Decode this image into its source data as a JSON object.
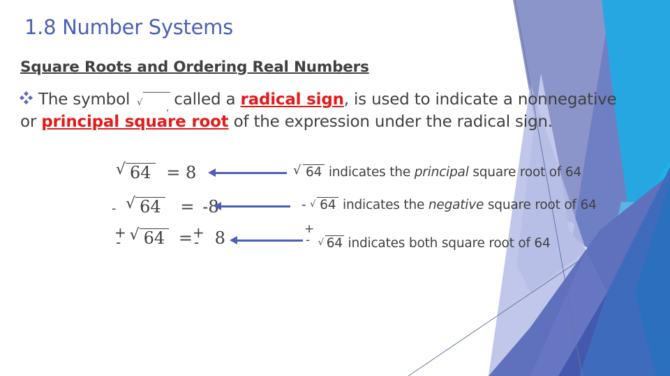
{
  "slide": {
    "title": "1.8 Number Systems",
    "subtitle": "Square Roots and Ordering Real Numbers",
    "bullet": {
      "icon": "diamond-bullet-icon",
      "text_before_symbol": "The symbol",
      "symbol": "√",
      "text_after_symbol": "called a",
      "term1": "radical sign",
      "text_mid": ", is used to indicate a nonnegative or",
      "term2": "principal square root",
      "text_end": "of the expression under the radical sign."
    },
    "equations": [
      {
        "prefix": "",
        "radicand": "64",
        "equals": "=",
        "result_prefix": "",
        "result": "8"
      },
      {
        "prefix": "-",
        "radicand": "64",
        "equals": "=",
        "result_prefix": "",
        "result": "-8"
      },
      {
        "prefix": "±",
        "radicand": "64",
        "equals": "=",
        "result_prefix": "±",
        "result": "8"
      }
    ],
    "descriptions": [
      {
        "prefix": "",
        "radicand": "64",
        "pre": "indicates the",
        "emph": "principal",
        "post": "square root of 64"
      },
      {
        "prefix": "-",
        "radicand": "64",
        "pre": "indicates the",
        "emph": "negative",
        "post": "square root of 64"
      },
      {
        "prefix": "±",
        "radicand": "64",
        "pre": "indicates both square root of 64",
        "emph": "",
        "post": ""
      }
    ],
    "colors": {
      "title": "#4a5fb5",
      "term": "#e31b1b",
      "text": "#404040",
      "arrow": "#4a5fb5"
    }
  }
}
